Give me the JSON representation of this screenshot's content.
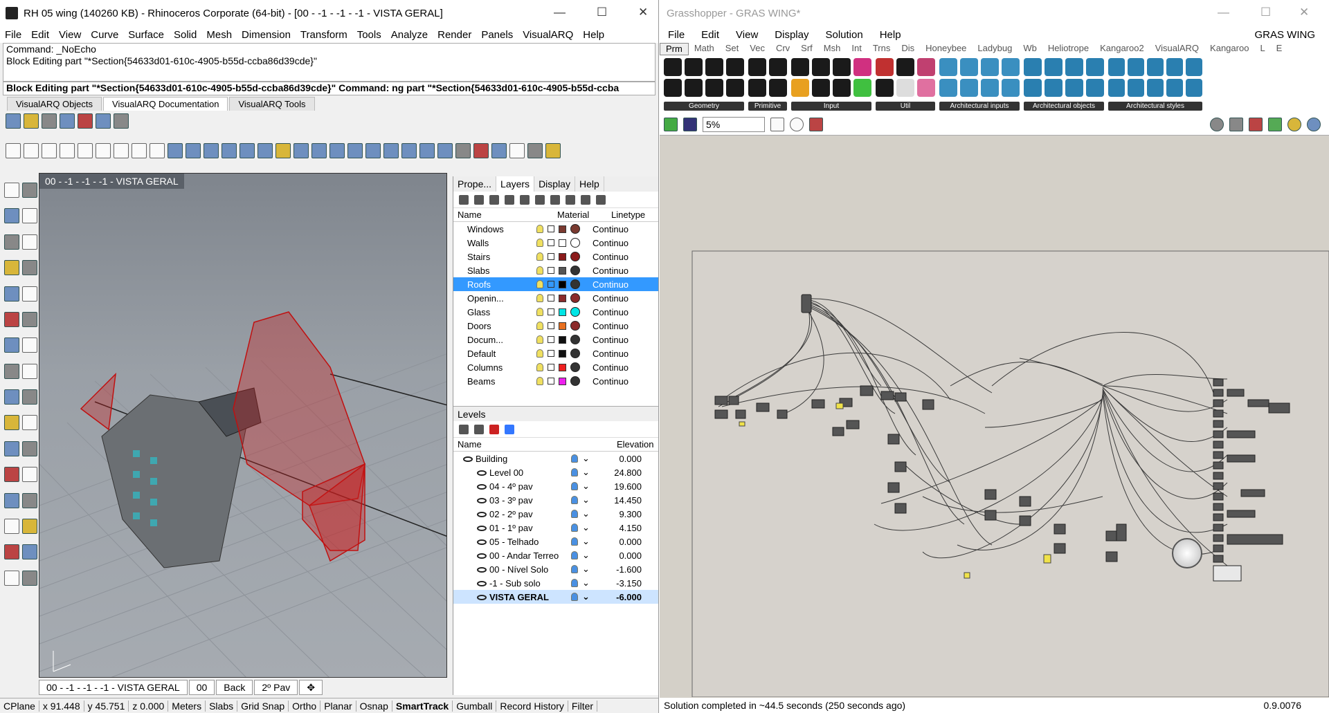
{
  "rhino": {
    "title": "RH 05 wing (140260 KB) - Rhinoceros Corporate (64-bit) - [00 - -1 - -1 - -1 - VISTA GERAL]",
    "menu": [
      "File",
      "Edit",
      "View",
      "Curve",
      "Surface",
      "Solid",
      "Mesh",
      "Dimension",
      "Transform",
      "Tools",
      "Analyze",
      "Render",
      "Panels",
      "VisualARQ",
      "Help"
    ],
    "command_history": [
      "Command: _NoEcho",
      "Block Editing part \"*Section{54633d01-610c-4905-b55d-ccba86d39cde}\""
    ],
    "command_line": "Block Editing part \"*Section{54633d01-610c-4905-b55d-ccba86d39cde}\"  Command: ng part \"*Section{54633d01-610c-4905-b55d-ccba",
    "toolbar_tabs": [
      "VisualARQ Objects",
      "VisualARQ Documentation",
      "VisualARQ Tools"
    ],
    "viewport_title": "00 - -1 - -1 - -1 - VISTA GERAL",
    "viewport_tabs": [
      "00 - -1 - -1 - -1 - VISTA GERAL",
      "00",
      "Back",
      "2º Pav"
    ],
    "status": [
      "CPlane",
      "x 91.448",
      "y 45.751",
      "z 0.000",
      "Meters",
      "Slabs",
      "Grid Snap",
      "Ortho",
      "Planar",
      "Osnap",
      "SmartTrack",
      "Gumball",
      "Record History",
      "Filter"
    ]
  },
  "panel": {
    "tabs": [
      "Prope...",
      "Layers",
      "Display",
      "Help"
    ],
    "columns": [
      "Name",
      "Material",
      "Linetype"
    ],
    "layers": [
      {
        "name": "Windows",
        "color": "#7a3a30",
        "mat": "#7a3a30",
        "lt": "Continuo"
      },
      {
        "name": "Walls",
        "color": "#ffffff",
        "mat": "",
        "lt": "Continuo"
      },
      {
        "name": "Stairs",
        "color": "#8b1a1a",
        "mat": "#8b1a1a",
        "lt": "Continuo"
      },
      {
        "name": "Slabs",
        "color": "#555555",
        "mat": "#333333",
        "lt": "Continuo"
      },
      {
        "name": "Roofs",
        "color": "#000000",
        "mat": "#333333",
        "lt": "Continuo"
      },
      {
        "name": "Openin...",
        "color": "#8b2a2a",
        "mat": "#8b2a2a",
        "lt": "Continuo"
      },
      {
        "name": "Glass",
        "color": "#00e5e5",
        "mat": "#00e5e5",
        "lt": "Continuo"
      },
      {
        "name": "Doors",
        "color": "#e87020",
        "mat": "#8b2a2a",
        "lt": "Continuo"
      },
      {
        "name": "Docum...",
        "color": "#111111",
        "mat": "#333333",
        "lt": "Continuo"
      },
      {
        "name": "Default",
        "color": "#111111",
        "mat": "#333333",
        "lt": "Continuo"
      },
      {
        "name": "Columns",
        "color": "#ee2020",
        "mat": "#333333",
        "lt": "Continuo"
      },
      {
        "name": "Beams",
        "color": "#ee20ee",
        "mat": "#333333",
        "lt": "Continuo"
      }
    ],
    "levels_title": "Levels",
    "levels_columns": [
      "Name",
      "Elevation"
    ],
    "levels": [
      {
        "name": "Building",
        "elev": "0.000"
      },
      {
        "name": "Level 00",
        "elev": "24.800"
      },
      {
        "name": "04 - 4º pav",
        "elev": "19.600"
      },
      {
        "name": "03 - 3º pav",
        "elev": "14.450"
      },
      {
        "name": "02 - 2º pav",
        "elev": "9.300"
      },
      {
        "name": "01 - 1º pav",
        "elev": "4.150"
      },
      {
        "name": "05 - Telhado",
        "elev": "0.000"
      },
      {
        "name": "00 - Andar Terreo",
        "elev": "0.000"
      },
      {
        "name": "00 - Nível Solo",
        "elev": "-1.600"
      },
      {
        "name": "-1 - Sub solo",
        "elev": "-3.150"
      },
      {
        "name": "VISTA GERAL",
        "elev": "-6.000"
      }
    ]
  },
  "gh": {
    "title": "Grasshopper - GRAS WING*",
    "menu": [
      "File",
      "Edit",
      "View",
      "Display",
      "Solution",
      "Help"
    ],
    "doc_name": "GRAS WING",
    "categories": [
      "Prm",
      "Math",
      "Set",
      "Vec",
      "Crv",
      "Srf",
      "Msh",
      "Int",
      "Trns",
      "Dis",
      "Honeybee",
      "Ladybug",
      "Wb",
      "Heliotrope",
      "Kangaroo2",
      "VisualARQ",
      "Kangaroo",
      "L",
      "E"
    ],
    "groups": [
      "Geometry",
      "Primitive",
      "Input",
      "Util",
      "Architectural inputs",
      "Architectural objects",
      "Architectural styles"
    ],
    "zoom": "5%",
    "status": "Solution completed in ~44.5 seconds (250 seconds ago)",
    "version": "0.9.0076"
  }
}
